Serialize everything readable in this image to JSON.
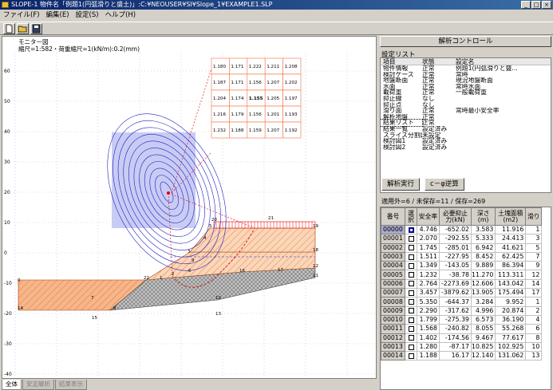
{
  "window": {
    "title": "SLOPE-1 物件名「例題1(円弧滑りと盛土)」:C:¥NEOUSER¥SI¥Slope_1¥EXAMPLE1.SLP",
    "minimize": "_",
    "maximize": "□",
    "close": "×"
  },
  "menu": [
    "ファイル(F)",
    "編集(E)",
    "設定(S)",
    "ヘルプ(H)"
  ],
  "toolbar_icons": [
    "new-file-icon",
    "open-folder-icon",
    "save-disk-icon"
  ],
  "canvas": {
    "monitor_label": "モニター図",
    "scale_label": "縮尺=1:582・荷重縮尺=1(kN/m):0.2(mm)",
    "y_ticks": [
      "60",
      "50",
      "40",
      "30",
      "20",
      "10",
      "0",
      "-10",
      "-20",
      "-30",
      "-40"
    ],
    "grid_values": [
      [
        "1.180",
        "1.171",
        "1.222",
        "1.211",
        "1.208"
      ],
      [
        "1.187",
        "1.171",
        "1.156",
        "1.207",
        "1.202"
      ],
      [
        "1.204",
        "1.174",
        "1.155",
        "1.205",
        "1.197"
      ],
      [
        "1.216",
        "1.179",
        "1.156",
        "1.201",
        "1.193"
      ],
      [
        "1.232",
        "1.188",
        "1.159",
        "1.207",
        "1.192"
      ]
    ],
    "point_labels": [
      "0",
      "1",
      "2",
      "3",
      "4",
      "5",
      "6",
      "7",
      "8",
      "9",
      "10",
      "11",
      "12",
      "13",
      "14",
      "15",
      "16",
      "17",
      "18",
      "19",
      "20",
      "21",
      "22"
    ],
    "colors": {
      "fill_layer": "#f7b58a",
      "clay_layer": "#c0c0c0",
      "slip_circle": "#e00000",
      "contour": "#2020c0",
      "grid_cell": "#ffffff"
    }
  },
  "sheet_tabs": [
    "全体",
    "安定解析",
    "結果表示"
  ],
  "panel": {
    "header": "解析コントロール",
    "settings_title": "設定リスト",
    "columns": [
      "項目",
      "状態",
      "設定名"
    ],
    "rows": [
      [
        "物件情報",
        "正常",
        "例題1(円弧滑りと盛..."
      ],
      [
        "検討ケース",
        "正常",
        "常時"
      ],
      [
        "地盤断面",
        "正常",
        "現況地盤断面"
      ],
      [
        "水面",
        "正常",
        "常時水面"
      ],
      [
        "載荷重",
        "正常",
        "一般載荷重"
      ],
      [
        "抑止線",
        "なし",
        ""
      ],
      [
        "抑止点",
        "なし",
        ""
      ],
      [
        "滑り面",
        "正常",
        "常時最小安全率"
      ],
      [
        "解析地盤",
        "正常",
        ""
      ],
      [
        "結果リスト",
        "正常",
        ""
      ],
      [
        "結果一覧",
        "設定済み",
        ""
      ],
      [
        "スライス分割図",
        "未設定",
        ""
      ],
      [
        "検討図1",
        "設定済み",
        ""
      ],
      [
        "検討図2",
        "設定済み",
        ""
      ]
    ],
    "run_button": "解析実行",
    "cphi_button": "c－φ逆算",
    "status": "適用外=6 / 未保存=11 / 保存=269",
    "result_columns": [
      "番号",
      "選択",
      "安全率",
      "必要抑止力(kN)",
      "深さ(m)",
      "土塊面積(m2)",
      "滑り"
    ],
    "results": [
      [
        "00000",
        "4.746",
        "-652.02",
        "3.583",
        "11.916",
        "1"
      ],
      [
        "00001",
        "2.070",
        "-292.55",
        "5.333",
        "24.413",
        "3"
      ],
      [
        "00002",
        "1.745",
        "-285.01",
        "6.942",
        "41.621",
        "5"
      ],
      [
        "00003",
        "1.511",
        "-227.95",
        "8.452",
        "62.425",
        "7"
      ],
      [
        "00004",
        "1.349",
        "-143.05",
        "9.889",
        "86.394",
        "9"
      ],
      [
        "00005",
        "1.232",
        "-38.78",
        "11.270",
        "113.311",
        "12"
      ],
      [
        "00006",
        "2.764",
        "-2273.69",
        "12.606",
        "143.042",
        "14"
      ],
      [
        "00007",
        "3.457",
        "-3879.62",
        "13.905",
        "175.494",
        "17"
      ],
      [
        "00008",
        "5.350",
        "-644.37",
        "3.284",
        "9.952",
        "1"
      ],
      [
        "00009",
        "2.290",
        "-317.62",
        "4.996",
        "20.874",
        "2"
      ],
      [
        "00010",
        "1.799",
        "-275.39",
        "6.573",
        "36.190",
        "4"
      ],
      [
        "00011",
        "1.568",
        "-240.82",
        "8.055",
        "55.268",
        "6"
      ],
      [
        "00012",
        "1.402",
        "-174.56",
        "9.467",
        "77.617",
        "8"
      ],
      [
        "00013",
        "1.280",
        "-87.17",
        "10.825",
        "102.925",
        "10"
      ],
      [
        "00014",
        "1.188",
        "16.17",
        "12.140",
        "131.062",
        "13"
      ]
    ]
  }
}
